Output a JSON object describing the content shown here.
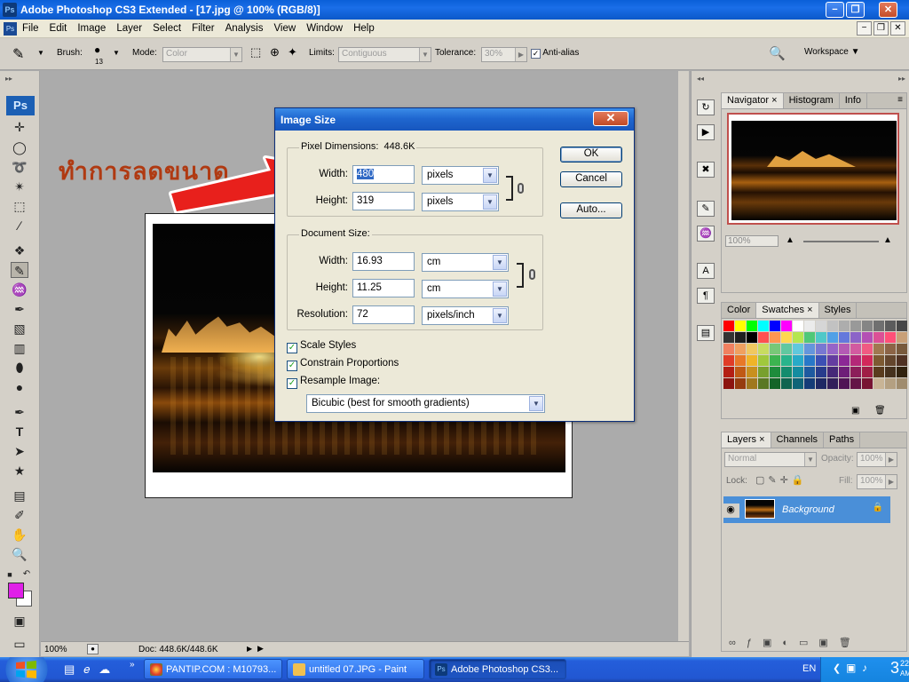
{
  "window": {
    "title": "Adobe Photoshop CS3 Extended - [17.jpg @ 100% (RGB/8)]",
    "app_icon": "Ps"
  },
  "menu": [
    "File",
    "Edit",
    "Image",
    "Layer",
    "Select",
    "Filter",
    "Analysis",
    "View",
    "Window",
    "Help"
  ],
  "options_bar": {
    "brush_label": "Brush:",
    "brush_size": "13",
    "mode_label": "Mode:",
    "mode_value": "Color",
    "limits_label": "Limits:",
    "limits_value": "Contiguous",
    "tolerance_label": "Tolerance:",
    "tolerance_value": "30%",
    "antialias_label": "Anti-alias",
    "workspace_label": "Workspace"
  },
  "annotation": {
    "thai_text": "ทำการลดขนาด",
    "arrow_color": "#e8201c"
  },
  "dialog": {
    "title": "Image Size",
    "pixel_dimensions_label": "Pixel Dimensions:",
    "pixel_dimensions_value": "448.6K",
    "width_label": "Width:",
    "width_value": "480",
    "height_label": "Height:",
    "height_value": "319",
    "pixels_unit": "pixels",
    "document_size_label": "Document Size:",
    "doc_width_value": "16.93",
    "doc_height_value": "11.25",
    "doc_unit": "cm",
    "resolution_label": "Resolution:",
    "resolution_value": "72",
    "resolution_unit": "pixels/inch",
    "scale_styles": "Scale Styles",
    "constrain_proportions": "Constrain Proportions",
    "resample_image": "Resample Image:",
    "resample_method": "Bicubic (best for smooth gradients)",
    "ok": "OK",
    "cancel": "Cancel",
    "auto": "Auto..."
  },
  "status": {
    "zoom": "100%",
    "doc": "Doc: 448.6K/448.6K"
  },
  "navigator": {
    "tabs": [
      "Navigator",
      "Histogram",
      "Info"
    ],
    "zoom": "100%"
  },
  "swatches_panel": {
    "tabs": [
      "Color",
      "Swatches",
      "Styles"
    ]
  },
  "layers_panel": {
    "tabs": [
      "Layers",
      "Channels",
      "Paths"
    ],
    "blend_mode": "Normal",
    "opacity_label": "Opacity:",
    "opacity_value": "100%",
    "lock_label": "Lock:",
    "fill_label": "Fill:",
    "fill_value": "100%",
    "layer_name": "Background"
  },
  "taskbar": {
    "tasks": [
      "PANTIP.COM : M10793...",
      "untitled 07.JPG - Paint",
      "Adobe Photoshop CS3..."
    ],
    "language": "EN",
    "clock": "3",
    "clock_minutes": "22",
    "clock_ampm": "AM"
  },
  "colors": {
    "foreground": "#e020e8",
    "background": "#ffffff",
    "selection": "#4a8fd8"
  }
}
